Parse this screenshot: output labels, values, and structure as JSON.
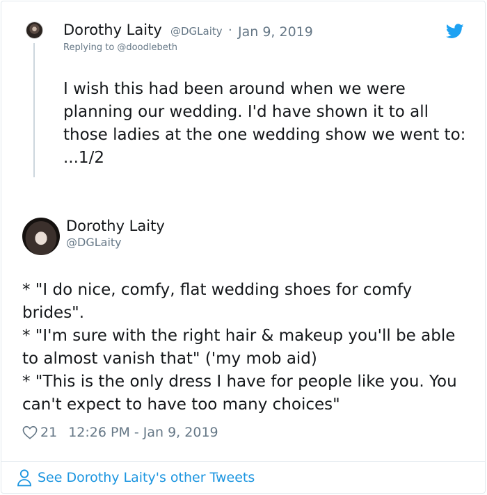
{
  "parent_tweet": {
    "name": "Dorothy Laity",
    "handle": "@DGLaity",
    "separator": "·",
    "date": "Jan 9, 2019",
    "replying_to": "Replying to @doodlebeth",
    "text": "I wish this had been around when we were planning our wedding. I'd have shown it to all those ladies at the one wedding show we went to: ...1/2",
    "icon": "twitter-bird-icon"
  },
  "main_tweet": {
    "name": "Dorothy Laity",
    "handle": "@DGLaity",
    "lines": [
      "* \"I do nice, comfy, flat wedding shoes for comfy brides\".",
      "* \"I'm sure with the right hair & makeup you'll be able to almost vanish that\" ('my mob aid)",
      "* \"This is the only dress I have for people like you. You can't expect to have too many choices\""
    ],
    "likes": "21",
    "timestamp": "12:26 PM - Jan 9, 2019"
  },
  "footer": {
    "link_text": "See Dorothy Laity's other Tweets",
    "icon": "person-icon"
  },
  "colors": {
    "brand_blue": "#1da1f2",
    "link_blue": "#1b95e0",
    "secondary_text": "#657786",
    "border": "#e1e8ed"
  }
}
